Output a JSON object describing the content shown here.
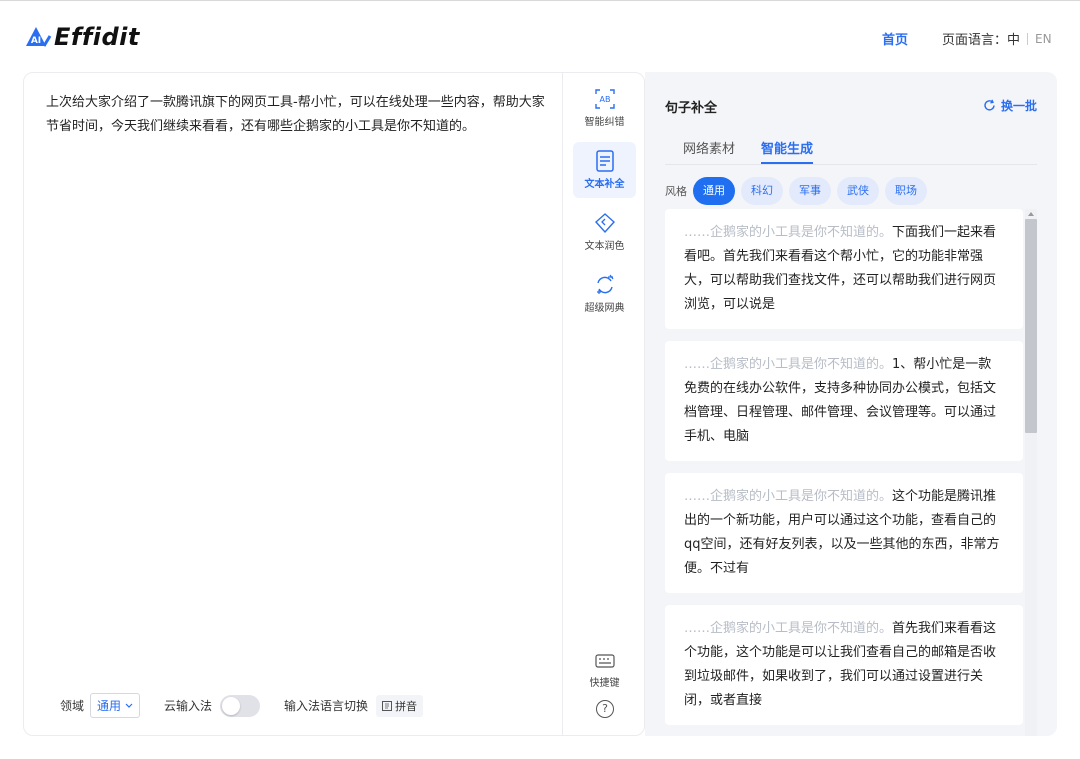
{
  "app": {
    "logo_badge": "AI",
    "logo_text": "Effidit",
    "nav_home": "首页",
    "lang_label": "页面语言：中",
    "lang_en": "EN",
    "accent": "#2a6ef2"
  },
  "editor": {
    "text": "上次给大家介绍了一款腾讯旗下的网页工具-帮小忙，可以在线处理一些内容，帮助大家节省时间，今天我们继续来看看，还有哪些企鹅家的小工具是你不知道的。",
    "footer": {
      "domain_label": "领域",
      "domain_value": "通用",
      "cloud_input_label": "云输入法",
      "lang_switch_label": "输入法语言切换",
      "pinyin_label": "拼音"
    }
  },
  "toolbar": {
    "items": [
      {
        "label": "智能纠错",
        "icon": "ab-correction-icon"
      },
      {
        "label": "文本补全",
        "icon": "document-icon",
        "active": true
      },
      {
        "label": "文本润色",
        "icon": "polish-diamond-icon"
      },
      {
        "label": "超级网典",
        "icon": "swap-icon"
      }
    ],
    "shortcut_label": "快捷键",
    "help_label": "?"
  },
  "panel": {
    "title": "句子补全",
    "refresh_label": "换一批",
    "tabs": [
      {
        "label": "网络素材",
        "active": false
      },
      {
        "label": "智能生成",
        "active": true
      }
    ],
    "style_label": "风格",
    "styles": [
      {
        "label": "通用",
        "active": true
      },
      {
        "label": "科幻",
        "active": false
      },
      {
        "label": "军事",
        "active": false
      },
      {
        "label": "武侠",
        "active": false
      },
      {
        "label": "职场",
        "active": false
      }
    ],
    "suggestions": [
      {
        "prefix": "……企鹅家的小工具是你不知道的。",
        "text": "下面我们一起来看看吧。首先我们来看看这个帮小忙，它的功能非常强大，可以帮助我们查找文件，还可以帮助我们进行网页浏览，可以说是"
      },
      {
        "prefix": "……企鹅家的小工具是你不知道的。",
        "text": "1、帮小忙是一款免费的在线办公软件，支持多种协同办公模式，包括文档管理、日程管理、邮件管理、会议管理等。可以通过手机、电脑"
      },
      {
        "prefix": "……企鹅家的小工具是你不知道的。",
        "text": "这个功能是腾讯推出的一个新功能，用户可以通过这个功能，查看自己的qq空间，还有好友列表，以及一些其他的东西，非常方便。不过有"
      },
      {
        "prefix": "……企鹅家的小工具是你不知道的。",
        "text": "首先我们来看看这个功能，这个功能是可以让我们查看自己的邮箱是否收到垃圾邮件，如果收到了，我们可以通过设置进行关闭，或者直接"
      }
    ]
  }
}
